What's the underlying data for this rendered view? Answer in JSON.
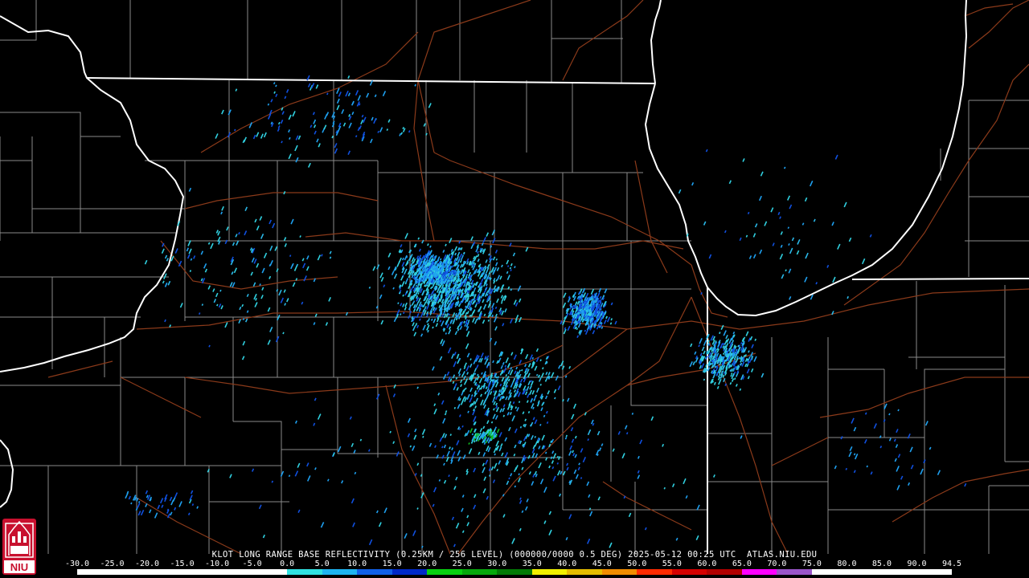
{
  "product": {
    "title": "KLOT LONG RANGE BASE REFLECTIVITY (0.25KM / 256 LEVEL) (000000/0000 0.5 DEG) 2025-05-12 00:25 UTC  ATLAS.NIU.EDU"
  },
  "scale": {
    "labels": [
      "-30.0",
      "-25.0",
      "-20.0",
      "-15.0",
      "-10.0",
      "-5.0",
      "0.0",
      "5.0",
      "10.0",
      "15.0",
      "20.0",
      "25.0",
      "30.0",
      "35.0",
      "40.0",
      "45.0",
      "50.0",
      "55.0",
      "60.0",
      "65.0",
      "70.0",
      "75.0",
      "80.0",
      "85.0",
      "90.0",
      "94.5"
    ],
    "colors": [
      "#ffffff",
      "#ffffff",
      "#ffffff",
      "#ffffff",
      "#ffffff",
      "#ffffff",
      "#30e0e0",
      "#1eb4f0",
      "#1060e8",
      "#0028c8",
      "#08d010",
      "#06a80c",
      "#037a06",
      "#f0f000",
      "#e4bc00",
      "#f08c00",
      "#ff2a00",
      "#d40000",
      "#b00000",
      "#ff00ff",
      "#9a55c8",
      "#ffffff",
      "#ffffff",
      "#ffffff",
      "#ffffff"
    ]
  },
  "logo": {
    "text": "NIU",
    "colors": {
      "red": "#c8102e",
      "white": "#ffffff"
    }
  },
  "map": {
    "background": "#000000",
    "colors": {
      "state": "#ffffff",
      "county": "#8a8a8a",
      "road": "#8b3a1a",
      "echo_light": "#30d0e0",
      "echo_mid": "#1ea0f0",
      "echo_dark": "#1050e0",
      "echo_green": "#10c020"
    }
  }
}
